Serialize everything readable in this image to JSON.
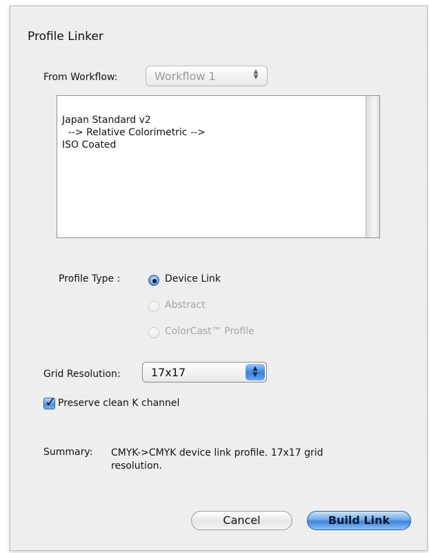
{
  "dialog": {
    "title": "Profile Linker"
  },
  "workflow": {
    "label": "From Workflow:",
    "selected": "Workflow 1"
  },
  "profile_text": {
    "lines": [
      "Japan Standard v2",
      "  --> Relative Colorimetric -->",
      "ISO Coated"
    ]
  },
  "profile_type": {
    "label": "Profile Type :",
    "options": [
      {
        "label": "Device Link",
        "selected": true,
        "enabled": true
      },
      {
        "label": "Abstract",
        "selected": false,
        "enabled": false
      },
      {
        "label": "ColorCast™ Profile",
        "selected": false,
        "enabled": false
      }
    ]
  },
  "grid_resolution": {
    "label": "Grid Resolution:",
    "selected": "17x17"
  },
  "preserve_k": {
    "label": "Preserve clean K channel",
    "checked": true
  },
  "summary": {
    "label": "Summary:",
    "text_line1": "CMYK->CMYK device link profile. 17x17 grid",
    "text_line2": "resolution."
  },
  "buttons": {
    "cancel": "Cancel",
    "build": "Build Link"
  },
  "colors": {
    "dialog_bg": "#ececec",
    "accent": "#3f84dc"
  }
}
